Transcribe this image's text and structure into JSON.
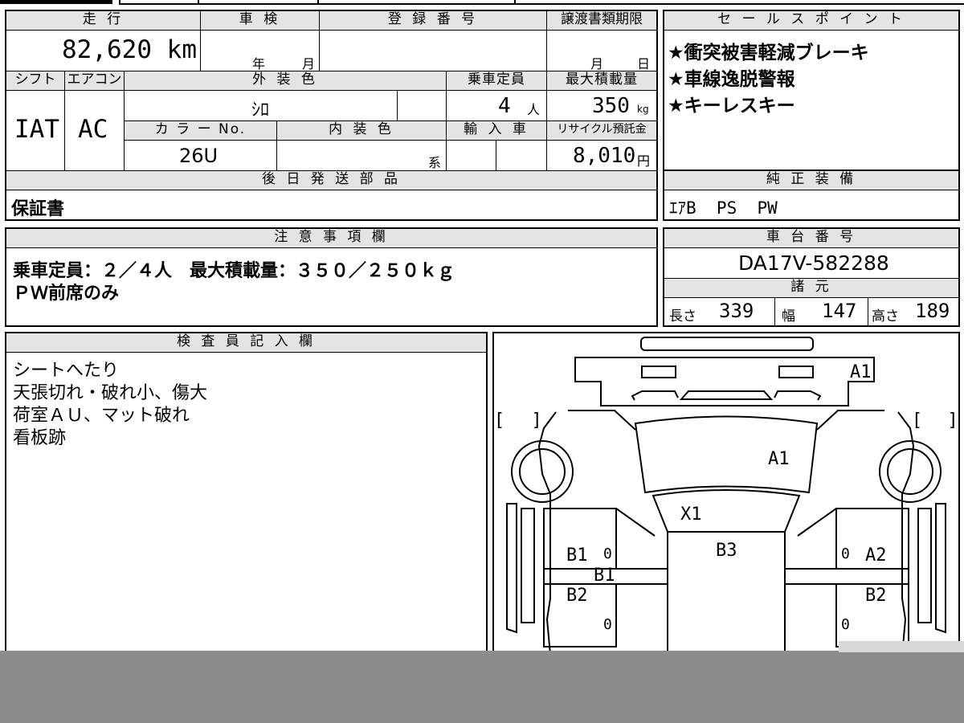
{
  "main": {
    "mileage_label": "走 行",
    "mileage_value": "82,620 km",
    "inspection_label": "車 検",
    "inspection_year": "年",
    "inspection_month": "月",
    "registration_label": "登 録 番 号",
    "transfer_label": "譲渡書類期限",
    "transfer_month": "月",
    "transfer_day": "日",
    "shift_label": "シフト",
    "shift_value": "IAT",
    "aircon_label": "エアコン",
    "aircon_value": "AC",
    "exterior_label": "外 装 色",
    "exterior_value": "ｼﾛ",
    "capacity_label": "乗車定員",
    "capacity_value": "4",
    "capacity_unit": "人",
    "maxload_label": "最大積載量",
    "maxload_value": "350",
    "maxload_unit": "kg",
    "colorno_label": "カ ラ ー No.",
    "colorno_value": "26U",
    "interior_label": "内 装 色",
    "interior_suffix": "系",
    "import_label": "輸 入 車",
    "recycle_label": "リサイクル預託金",
    "recycle_value": "8,010",
    "recycle_unit": "円",
    "later_label": "後 日 発 送 部 品",
    "later_value": "保証書"
  },
  "sales": {
    "label": "セ ー ル ス ポ イ ン ト",
    "items": [
      "★衝突被害軽減ブレーキ",
      "★車線逸脱警報",
      "★キーレスキー"
    ]
  },
  "equipment": {
    "label": "純 正 装 備",
    "value": "ｴｱB  PS  PW"
  },
  "notes": {
    "label": "注 意 事 項 欄",
    "line1": "乗車定員：２／４人　最大積載量：３５０／２５０ｋｇ",
    "line2": "ＰＷ前席のみ"
  },
  "chassis": {
    "label": "車 台 番 号",
    "value": "DA17V-582288"
  },
  "specs": {
    "label": "諸 元",
    "length_label": "長さ",
    "length_value": "339",
    "width_label": "幅",
    "width_value": "147",
    "height_label": "高さ",
    "height_value": "189"
  },
  "inspector": {
    "label": "検 査 員 記 入 欄",
    "lines": [
      "シートへたり",
      "天張切れ・破れ小、傷大",
      "荷室ＡＵ、マット破れ",
      "看板跡"
    ]
  },
  "diagram": {
    "marks": {
      "front_top": "A1",
      "hood": "A1",
      "windshield": "X1",
      "roof": "B3",
      "left_front_door": "B1",
      "left_mid": "B1",
      "left_rear_door": "B2",
      "right_front_door": "A2",
      "right_rear_door": "B2",
      "zero_1": "0",
      "zero_2": "0",
      "zero_3": "0",
      "zero_4": "0"
    },
    "brackets": {
      "open": "[",
      "close": "]"
    }
  },
  "colors": {
    "header_bg": "#e4e4e4",
    "footer_bar": "#8c8c8c"
  }
}
